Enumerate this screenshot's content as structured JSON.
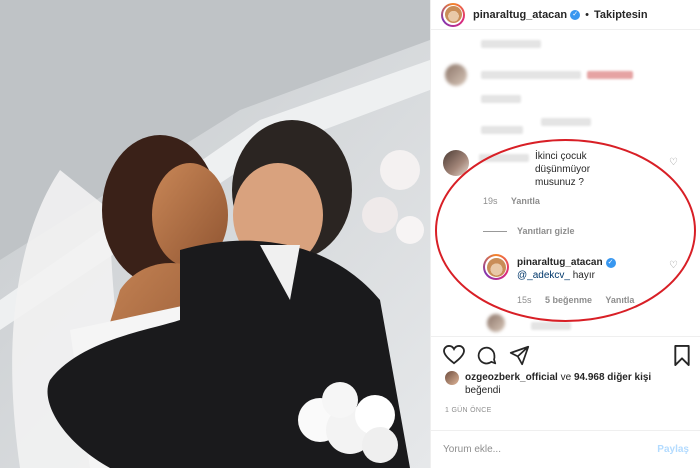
{
  "post": {
    "author": "pinaraltug_atacan",
    "follow_state": "Takiptesin",
    "separator": "•"
  },
  "highlighted_comment": {
    "text": "İkinci çocuk düşünmüyor musunuz ?",
    "time": "19s",
    "reply_label": "Yanıtla",
    "hide_replies_label": "Yanıtları gizle"
  },
  "reply": {
    "author": "pinaraltug_atacan",
    "mention": "@_adekcv_",
    "text": "hayır",
    "time": "15s",
    "likes": "5 beğenme",
    "reply_label": "Yanıtla"
  },
  "likes": {
    "user": "ozgeozberk_official",
    "connector": "ve",
    "count": "94.968 diğer kişi",
    "suffix": "beğendi"
  },
  "post_age": "1 GÜN ÖNCE",
  "comment_input": {
    "placeholder": "Yorum ekle...",
    "submit_label": "Paylaş"
  },
  "icons": {
    "verified": "verified-badge-icon",
    "like": "heart-icon",
    "comment": "comment-bubble-icon",
    "share": "paper-plane-icon",
    "save": "bookmark-icon"
  },
  "colors": {
    "highlight_ellipse": "#d81f26",
    "verified": "#3897f0",
    "post_button": "#b3dbff"
  }
}
